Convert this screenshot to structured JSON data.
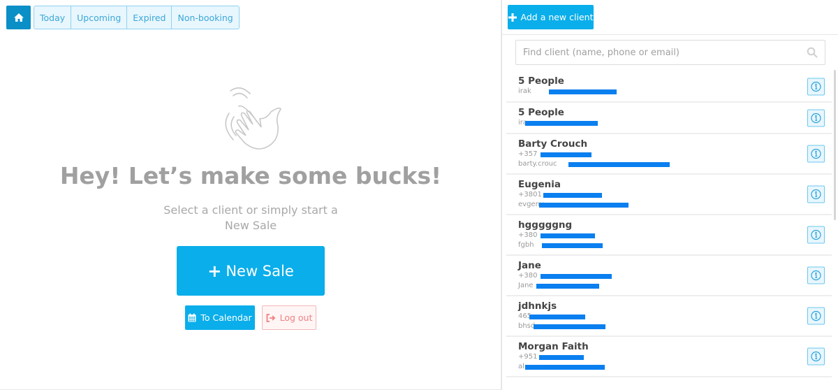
{
  "nav": {
    "home_icon": "home-icon",
    "tabs": [
      {
        "label": "Today"
      },
      {
        "label": "Upcoming"
      },
      {
        "label": "Expired"
      },
      {
        "label": "Non-booking"
      }
    ]
  },
  "welcome": {
    "illustration": "waving-hand-icon",
    "headline": "Hey! Let’s make some bucks!",
    "subtitle_line1": "Select a client or simply start a",
    "subtitle_line2": "New Sale",
    "new_sale_plus": "+",
    "new_sale_label": "New Sale",
    "calendar_label": "To Calendar",
    "logout_label": "Log out"
  },
  "clients_panel": {
    "add_label": "Add a new client",
    "search_placeholder": "Find client (name, phone or email)",
    "clients": [
      {
        "name": "5 People",
        "lines": [
          {
            "text": "irak",
            "redacted": true
          }
        ]
      },
      {
        "name": "5 People",
        "lines": [
          {
            "text": "ira",
            "redacted": true
          }
        ]
      },
      {
        "name": "Barty Crouch",
        "lines": [
          {
            "text": "+357",
            "redacted": true
          },
          {
            "text": "barty.crouc",
            "redacted": true
          }
        ]
      },
      {
        "name": "Eugenia",
        "lines": [
          {
            "text": "+3801",
            "redacted": true
          },
          {
            "text": "evgeny",
            "redacted": true
          }
        ]
      },
      {
        "name": "hgggggng",
        "lines": [
          {
            "text": "+380",
            "redacted": true
          },
          {
            "text": "fgbh",
            "redacted": true
          }
        ]
      },
      {
        "name": "Jane",
        "lines": [
          {
            "text": "+380",
            "redacted": true
          },
          {
            "text": "Jane",
            "redacted": true
          }
        ]
      },
      {
        "name": "jdhnkjs",
        "lines": [
          {
            "text": "465",
            "redacted": true
          },
          {
            "text": "bhsd",
            "redacted": true
          }
        ]
      },
      {
        "name": "Morgan Faith",
        "lines": [
          {
            "text": "+951",
            "redacted": true
          },
          {
            "text": "al",
            "redacted": true
          }
        ]
      }
    ]
  },
  "colors": {
    "primary": "#0aaeea",
    "home": "#0a8fc7",
    "redaction": "#0a7ff0",
    "logout": "#f08080"
  }
}
